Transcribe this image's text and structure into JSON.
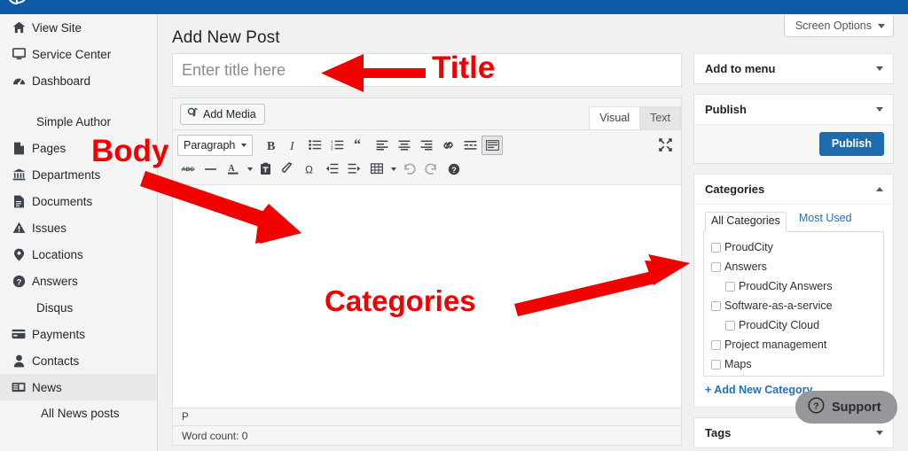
{
  "brand": {
    "adminbar_color": "#0d5ba6",
    "logo": "leaf-logo",
    "accent_blue": "#1f6cac",
    "link_blue": "#2271b1",
    "annotation_red": "#f20000"
  },
  "sidebar": {
    "items": [
      {
        "label": "View Site",
        "icon": "home-icon",
        "has_icon": true,
        "highlight": false
      },
      {
        "label": "Service Center",
        "icon": "monitor-icon",
        "has_icon": true,
        "highlight": false
      },
      {
        "label": "Dashboard",
        "icon": "dashboard-icon",
        "has_icon": true,
        "highlight": false
      },
      {
        "label": "Simple Author",
        "icon": "",
        "has_icon": false,
        "highlight": false
      },
      {
        "label": "Pages",
        "icon": "page-icon",
        "has_icon": true,
        "highlight": false
      },
      {
        "label": "Departments",
        "icon": "bank-icon",
        "has_icon": true,
        "highlight": false
      },
      {
        "label": "Documents",
        "icon": "document-icon",
        "has_icon": true,
        "highlight": false
      },
      {
        "label": "Issues",
        "icon": "warning-icon",
        "has_icon": true,
        "highlight": false
      },
      {
        "label": "Locations",
        "icon": "pin-icon",
        "has_icon": true,
        "highlight": false
      },
      {
        "label": "Answers",
        "icon": "question-icon",
        "has_icon": true,
        "highlight": false
      },
      {
        "label": "Disqus",
        "icon": "",
        "has_icon": false,
        "highlight": false
      },
      {
        "label": "Payments",
        "icon": "card-icon",
        "has_icon": true,
        "highlight": false
      },
      {
        "label": "Contacts",
        "icon": "user-icon",
        "has_icon": true,
        "highlight": false
      },
      {
        "label": "News",
        "icon": "news-icon",
        "has_icon": true,
        "highlight": true
      }
    ],
    "submenu": [
      {
        "label": "All News posts"
      }
    ]
  },
  "header": {
    "screen_options_label": "Screen Options",
    "page_title": "Add New Post"
  },
  "editor": {
    "title_placeholder": "Enter title here",
    "title_value": "",
    "add_media_label": "Add Media",
    "tabs": [
      {
        "label": "Visual",
        "active": true
      },
      {
        "label": "Text",
        "active": false
      }
    ],
    "format_select": "Paragraph",
    "toolbar_row1": [
      "bold-icon",
      "italic-icon",
      "bulleted-list-icon",
      "numbered-list-icon",
      "blockquote-icon",
      "align-left-icon",
      "align-center-icon",
      "align-right-icon",
      "link-icon",
      "read-more-icon",
      "toolbar-toggle-icon"
    ],
    "toolbar_row1_right": [
      "fullscreen-icon"
    ],
    "toolbar_row2": [
      "strikethrough-icon",
      "horizontal-rule-icon",
      "text-color-icon",
      "paste-as-text-icon",
      "clear-formatting-icon",
      "special-character-icon",
      "outdent-icon",
      "indent-icon",
      "table-icon",
      "undo-icon",
      "redo-icon",
      "help-icon"
    ],
    "path_bar": "P",
    "word_count": "Word count: 0"
  },
  "panels": {
    "add_to_menu": {
      "title": "Add to menu",
      "state": "collapsed"
    },
    "publish": {
      "title": "Publish",
      "state": "collapsed",
      "button_label": "Publish"
    },
    "categories": {
      "title": "Categories",
      "state": "expanded",
      "tabs": [
        {
          "label": "All Categories",
          "active": true
        },
        {
          "label": "Most Used",
          "active": false
        }
      ],
      "items": [
        {
          "label": "ProudCity",
          "checked": false,
          "indent": false
        },
        {
          "label": "Answers",
          "checked": false,
          "indent": false
        },
        {
          "label": "ProudCity Answers",
          "checked": false,
          "indent": true
        },
        {
          "label": "Software-as-a-service",
          "checked": false,
          "indent": false
        },
        {
          "label": "ProudCity Cloud",
          "checked": false,
          "indent": true
        },
        {
          "label": "Project management",
          "checked": false,
          "indent": false
        },
        {
          "label": "Maps",
          "checked": false,
          "indent": false
        }
      ],
      "add_new_label": "+ Add New Category"
    },
    "tags": {
      "title": "Tags",
      "state": "collapsed"
    }
  },
  "support_widget": {
    "label": "Support",
    "icon": "question-circle-icon"
  },
  "annotations": [
    {
      "id": "title-annotation",
      "text": "Title"
    },
    {
      "id": "body-annotation",
      "text": "Body"
    },
    {
      "id": "categories-annotation",
      "text": "Categories"
    }
  ]
}
